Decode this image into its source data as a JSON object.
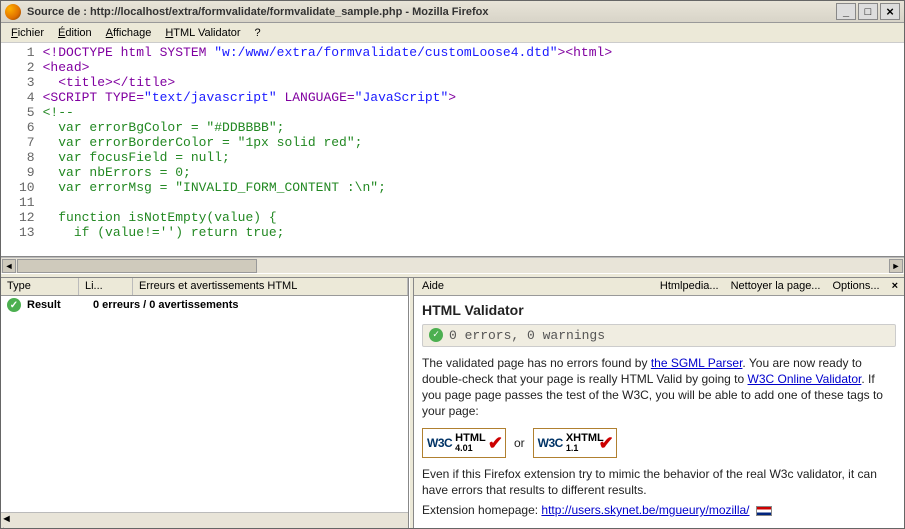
{
  "window": {
    "title": "Source de : http://localhost/extra/formvalidate/formvalidate_sample.php - Mozilla Firefox"
  },
  "menu": {
    "file": "Fichier",
    "edit": "Édition",
    "view": "Affichage",
    "htmlval": "HTML Validator",
    "help": "?"
  },
  "source": {
    "lines": [
      {
        "n": 1,
        "html": "<span class='c-tag'>&lt;!DOCTYPE html SYSTEM <span class='c-str'>\"w:/www/extra/formvalidate/customLoose4.dtd\"</span>&gt;</span><span class='c-tag'>&lt;html&gt;</span>"
      },
      {
        "n": 2,
        "html": "<span class='c-tag'>&lt;head&gt;</span>"
      },
      {
        "n": 3,
        "html": "  <span class='c-tag'>&lt;title&gt;&lt;/title&gt;</span>"
      },
      {
        "n": 4,
        "html": "<span class='c-tag'>&lt;SCRIPT TYPE=<span class='c-str'>\"text/javascript\"</span> LANGUAGE=<span class='c-str'>\"JavaScript\"</span>&gt;</span>"
      },
      {
        "n": 5,
        "html": "<span class='c-cmt'>&lt;!--</span>"
      },
      {
        "n": 6,
        "html": "<span class='c-cmt'>  var errorBgColor = \"#DDBBBB\";</span>"
      },
      {
        "n": 7,
        "html": "<span class='c-cmt'>  var errorBorderColor = \"1px solid red\";</span>"
      },
      {
        "n": 8,
        "html": "<span class='c-cmt'>  var focusField = null;</span>"
      },
      {
        "n": 9,
        "html": "<span class='c-cmt'>  var nbErrors = 0;</span>"
      },
      {
        "n": 10,
        "html": "<span class='c-cmt'>  var errorMsg = \"INVALID_FORM_CONTENT :\\n\";</span>"
      },
      {
        "n": 11,
        "html": "<span class='c-cmt'> </span>"
      },
      {
        "n": 12,
        "html": "<span class='c-cmt'>  function isNotEmpty(value) {</span>"
      },
      {
        "n": 13,
        "html": "<span class='c-cmt'>    if (value!='') return true;</span>"
      }
    ]
  },
  "errors_pane": {
    "headers": {
      "type": "Type",
      "line": "Li...",
      "msg": "Erreurs et avertissements HTML"
    },
    "row": {
      "type": "Result",
      "msg": "0 erreurs / 0 avertissements"
    }
  },
  "help_pane": {
    "header": {
      "label": "Aide",
      "htmlpedia": "Htmlpedia...",
      "clean": "Nettoyer la page...",
      "options": "Options..."
    },
    "title": "HTML Validator",
    "status": "0 errors, 0 warnings",
    "p1a": "The validated page has no errors found by ",
    "p1link": "the SGML Parser",
    "p1b": ". You are now ready to double-check that your page is really HTML Valid by going to ",
    "p1link2": "W3C Online Validator",
    "p1c": ". If you page page passes the test of the W3C, you will be able to add one of these tags to your page:",
    "or": "or",
    "p2": "Even if this Firefox extension try to mimic the behavior of the real W3c validator, it can have errors that results to different results.",
    "p3a": "Extension homepage: ",
    "p3link": "http://users.skynet.be/mgueury/mozilla/",
    "badge1": {
      "w3c": "W3C",
      "line1": "HTML",
      "line2": "4.01"
    },
    "badge2": {
      "w3c": "W3C",
      "line1": "XHTML",
      "line2": "1.1"
    }
  }
}
